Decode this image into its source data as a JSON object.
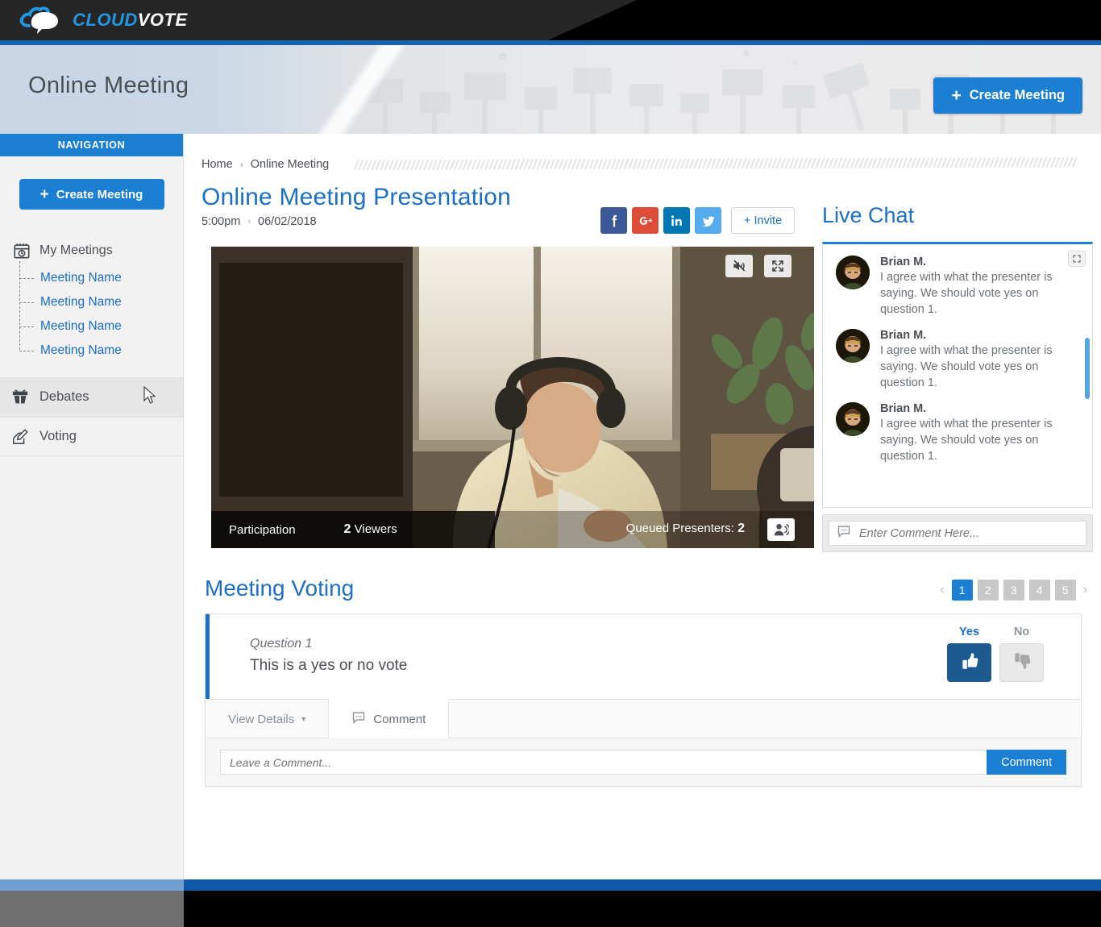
{
  "brand": {
    "name_part1": "CLOUD",
    "name_part2": "VOTE",
    "logo_icon": "cloud-speech-icon"
  },
  "header": {
    "page_title": "Online Meeting",
    "create_button": "Create Meeting",
    "create_plus": "+"
  },
  "sidebar": {
    "nav_header": "NAVIGATION",
    "create_button": "Create Meeting",
    "create_plus": "+",
    "my_meetings_label": "My Meetings",
    "my_meetings_icon": "calendar-clock-icon",
    "meetings": [
      {
        "label": "Meeting Name"
      },
      {
        "label": "Meeting Name"
      },
      {
        "label": "Meeting Name"
      },
      {
        "label": "Meeting Name"
      }
    ],
    "items": [
      {
        "label": "Debates",
        "icon": "podium-icon"
      },
      {
        "label": "Voting",
        "icon": "ballot-pen-icon"
      }
    ]
  },
  "breadcrumb": {
    "home": "Home",
    "separator": "›",
    "current": "Online Meeting"
  },
  "meeting": {
    "title": "Online Meeting Presentation",
    "time": "5:00pm",
    "separator": "›",
    "date": "06/02/2018",
    "invite_label": "+ Invite",
    "social": [
      {
        "name": "facebook-icon",
        "color": "#3b5998"
      },
      {
        "name": "google-plus-icon",
        "color": "#dd4b39"
      },
      {
        "name": "linkedin-icon",
        "color": "#0077b5"
      },
      {
        "name": "twitter-icon",
        "color": "#55acee"
      }
    ]
  },
  "video": {
    "mute_icon": "mute-icon",
    "fullscreen_icon": "fullscreen-icon",
    "participation_label": "Participation",
    "viewers_count": "2",
    "viewers_label": "Viewers",
    "queued_label": "Queued Presenters:",
    "queued_count": "2",
    "presenter_icon": "presenter-speaking-icon"
  },
  "chat": {
    "title": "Live Chat",
    "expand_icon": "expand-icon",
    "messages": [
      {
        "name": "Brian M.",
        "text": "I agree with what the presenter is saying. We should vote yes on question 1."
      },
      {
        "name": "Brian M.",
        "text": "I agree with what the presenter is saying. We should vote yes on question 1."
      },
      {
        "name": "Brian M.",
        "text": "I agree with what the presenter is saying. We should vote yes on question 1."
      }
    ],
    "input_placeholder": "Enter Comment Here...",
    "input_value": "",
    "input_icon": "comment-bubble-icon"
  },
  "voting": {
    "title": "Meeting Voting",
    "pagination": {
      "prev": "‹",
      "next": "›",
      "pages": [
        "1",
        "2",
        "3",
        "4",
        "5"
      ],
      "active": "1"
    },
    "question_label": "Question 1",
    "question_text": "This is a yes or no vote",
    "yes_label": "Yes",
    "no_label": "No",
    "yes_icon": "thumbs-up-icon",
    "no_icon": "thumbs-down-icon",
    "tabs": [
      {
        "label": "View Details",
        "caret": "▾",
        "icon": ""
      },
      {
        "label": "Comment",
        "caret": "",
        "icon": "comment-bubble-icon"
      }
    ],
    "comment_placeholder": "Leave a Comment...",
    "comment_value": "",
    "comment_button": "Comment"
  },
  "colors": {
    "accent_blue": "#1b7fd4",
    "link_blue": "#1b6fc4",
    "vote_yes_blue": "#1d5a8f",
    "footer_blue": "#0e59a7"
  }
}
